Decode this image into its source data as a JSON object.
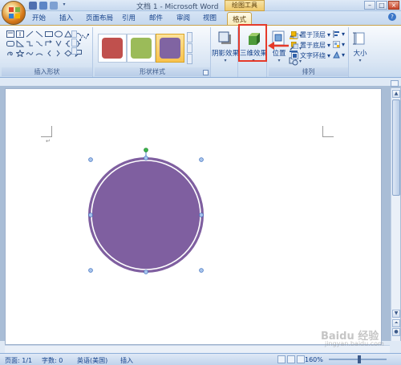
{
  "window": {
    "title": "文档 1 - Microsoft Word",
    "context_tab_title": "绘图工具",
    "controls": {
      "minimize": "–",
      "maximize": "□",
      "close": "×"
    }
  },
  "tabs": [
    {
      "label": "开始",
      "active": false
    },
    {
      "label": "插入",
      "active": false
    },
    {
      "label": "页面布局",
      "active": false
    },
    {
      "label": "引用",
      "active": false
    },
    {
      "label": "邮件",
      "active": false
    },
    {
      "label": "审阅",
      "active": false
    },
    {
      "label": "视图",
      "active": false
    },
    {
      "label": "格式",
      "active": true
    }
  ],
  "ribbon": {
    "groups": {
      "insert_shapes": "插入形状",
      "shape_styles": "形状样式",
      "arrange": "排列"
    },
    "shadow_effects": "阴影效果",
    "three_d_effects": "三维效果",
    "position": "位置",
    "bring_to_front": "置于顶层",
    "send_to_back": "置于底层",
    "text_wrapping": "文字环绕",
    "size": "大小",
    "style_swatches": [
      {
        "color": "#c0504d"
      },
      {
        "color": "#9bbb59"
      },
      {
        "color": "#8064a2",
        "selected": true
      }
    ]
  },
  "colors": {
    "shape_fill": "#7f5fa0",
    "highlight": "#e53a2a",
    "selection_handle": "#4a78c2",
    "rotation_handle": "#39b54a"
  },
  "document": {
    "paragraph_mark": "↵",
    "shape": {
      "type": "circle",
      "selected": true
    }
  },
  "statusbar": {
    "page": "页面: 1/1",
    "words": "字数: 0",
    "language": "英语(美国)",
    "mode": "插入",
    "zoom": "160%"
  },
  "watermark": {
    "text": "Baidu 经验",
    "url": "jingyan.baidu.com"
  }
}
